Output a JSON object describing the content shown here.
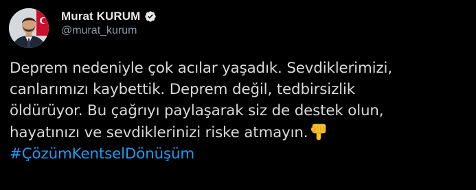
{
  "author": {
    "display_name": "Murat KURUM",
    "handle": "@murat_kurum",
    "verified_icon": "verified-badge-icon",
    "avatar_icon": "profile-photo"
  },
  "tweet": {
    "lines": [
      "Deprem nedeniyle çok acılar yaşadık. Sevdiklerimizi,",
      "canlarımızı kaybettik. Deprem değil, tedbirsizlik",
      "öldürüyor. Bu çağrıyı paylaşarak siz de destek olun,",
      "hayatınızı ve sevdiklerinizi riske atmayın."
    ],
    "emoji": "backhand-index-pointing-down-icon",
    "hashtag": "#ÇözümKentselDönüşüm"
  },
  "colors": {
    "background": "#000000",
    "text": "#d9d9d9",
    "name": "#e7e9ea",
    "handle": "#8b98a5",
    "link": "#1d9bf0",
    "verified": "#e7e9ea"
  }
}
